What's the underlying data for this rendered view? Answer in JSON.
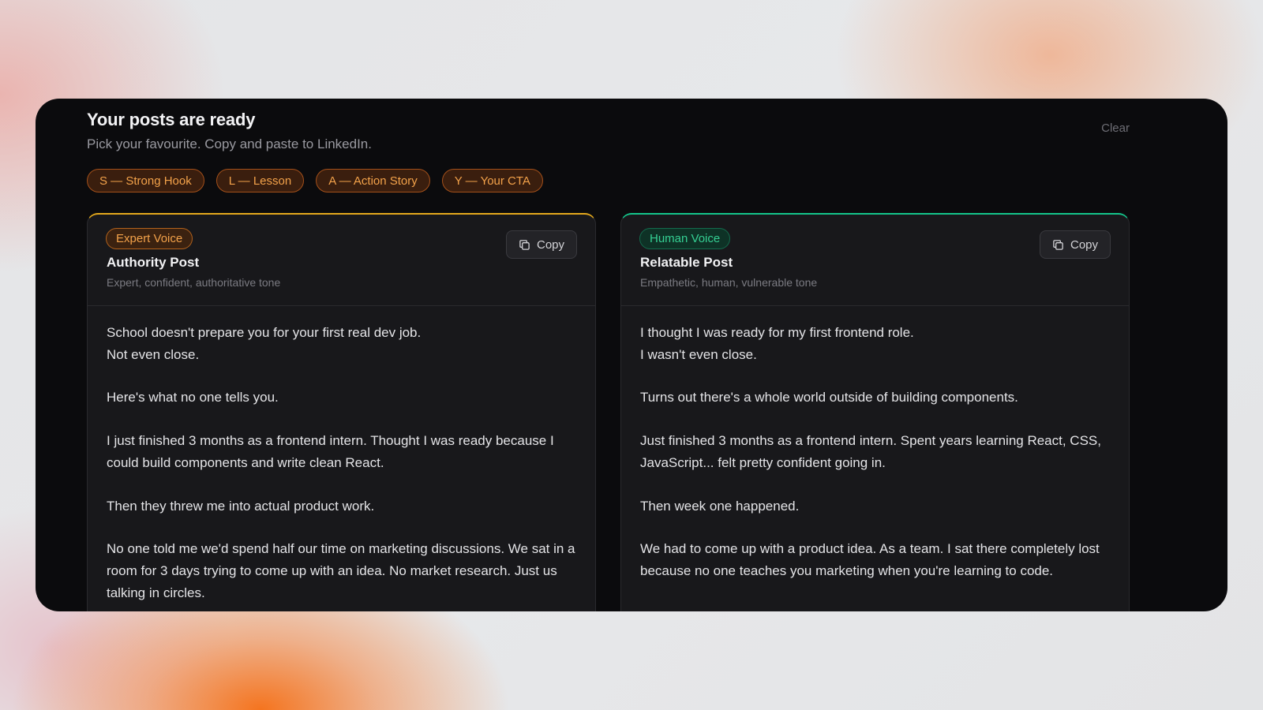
{
  "header": {
    "title": "Your posts are ready",
    "subtitle": "Pick your favourite. Copy and paste to LinkedIn.",
    "clear_label": "Clear"
  },
  "tags": [
    {
      "label": "S — Strong Hook"
    },
    {
      "label": "L — Lesson"
    },
    {
      "label": "A — Action Story"
    },
    {
      "label": "Y — Your CTA"
    }
  ],
  "colors": {
    "panel_background": "#0b0b0d",
    "card_background": "#18181b",
    "expert_accent": "#e3a81c",
    "human_accent": "#14c48a",
    "tag_text": "#f3a24a"
  },
  "cards": [
    {
      "badge": "Expert Voice",
      "title": "Authority Post",
      "description": "Expert, confident, authoritative tone",
      "copy_label": "Copy",
      "copy_icon": "copy-icon",
      "paragraphs": [
        [
          "School doesn't prepare you for your first real dev job.",
          "Not even close."
        ],
        [
          "Here's what no one tells you."
        ],
        [
          "I just finished 3 months as a frontend intern. Thought I was ready because I could build components and write clean React."
        ],
        [
          "Then they threw me into actual product work."
        ],
        [
          "No one told me we'd spend half our time on marketing discussions. We sat in a room for 3 days trying to come up with an idea. No market research. Just us talking in circles."
        ]
      ]
    },
    {
      "badge": "Human Voice",
      "title": "Relatable Post",
      "description": "Empathetic, human, vulnerable tone",
      "copy_label": "Copy",
      "copy_icon": "copy-icon",
      "paragraphs": [
        [
          "I thought I was ready for my first frontend role.",
          "I wasn't even close."
        ],
        [
          "Turns out there's a whole world outside of building components."
        ],
        [
          "Just finished 3 months as a frontend intern. Spent years learning React, CSS, JavaScript... felt pretty confident going in."
        ],
        [
          "Then week one happened."
        ],
        [
          "We had to come up with a product idea. As a team. I sat there completely lost because no one teaches you marketing when you're learning to code."
        ]
      ]
    }
  ]
}
